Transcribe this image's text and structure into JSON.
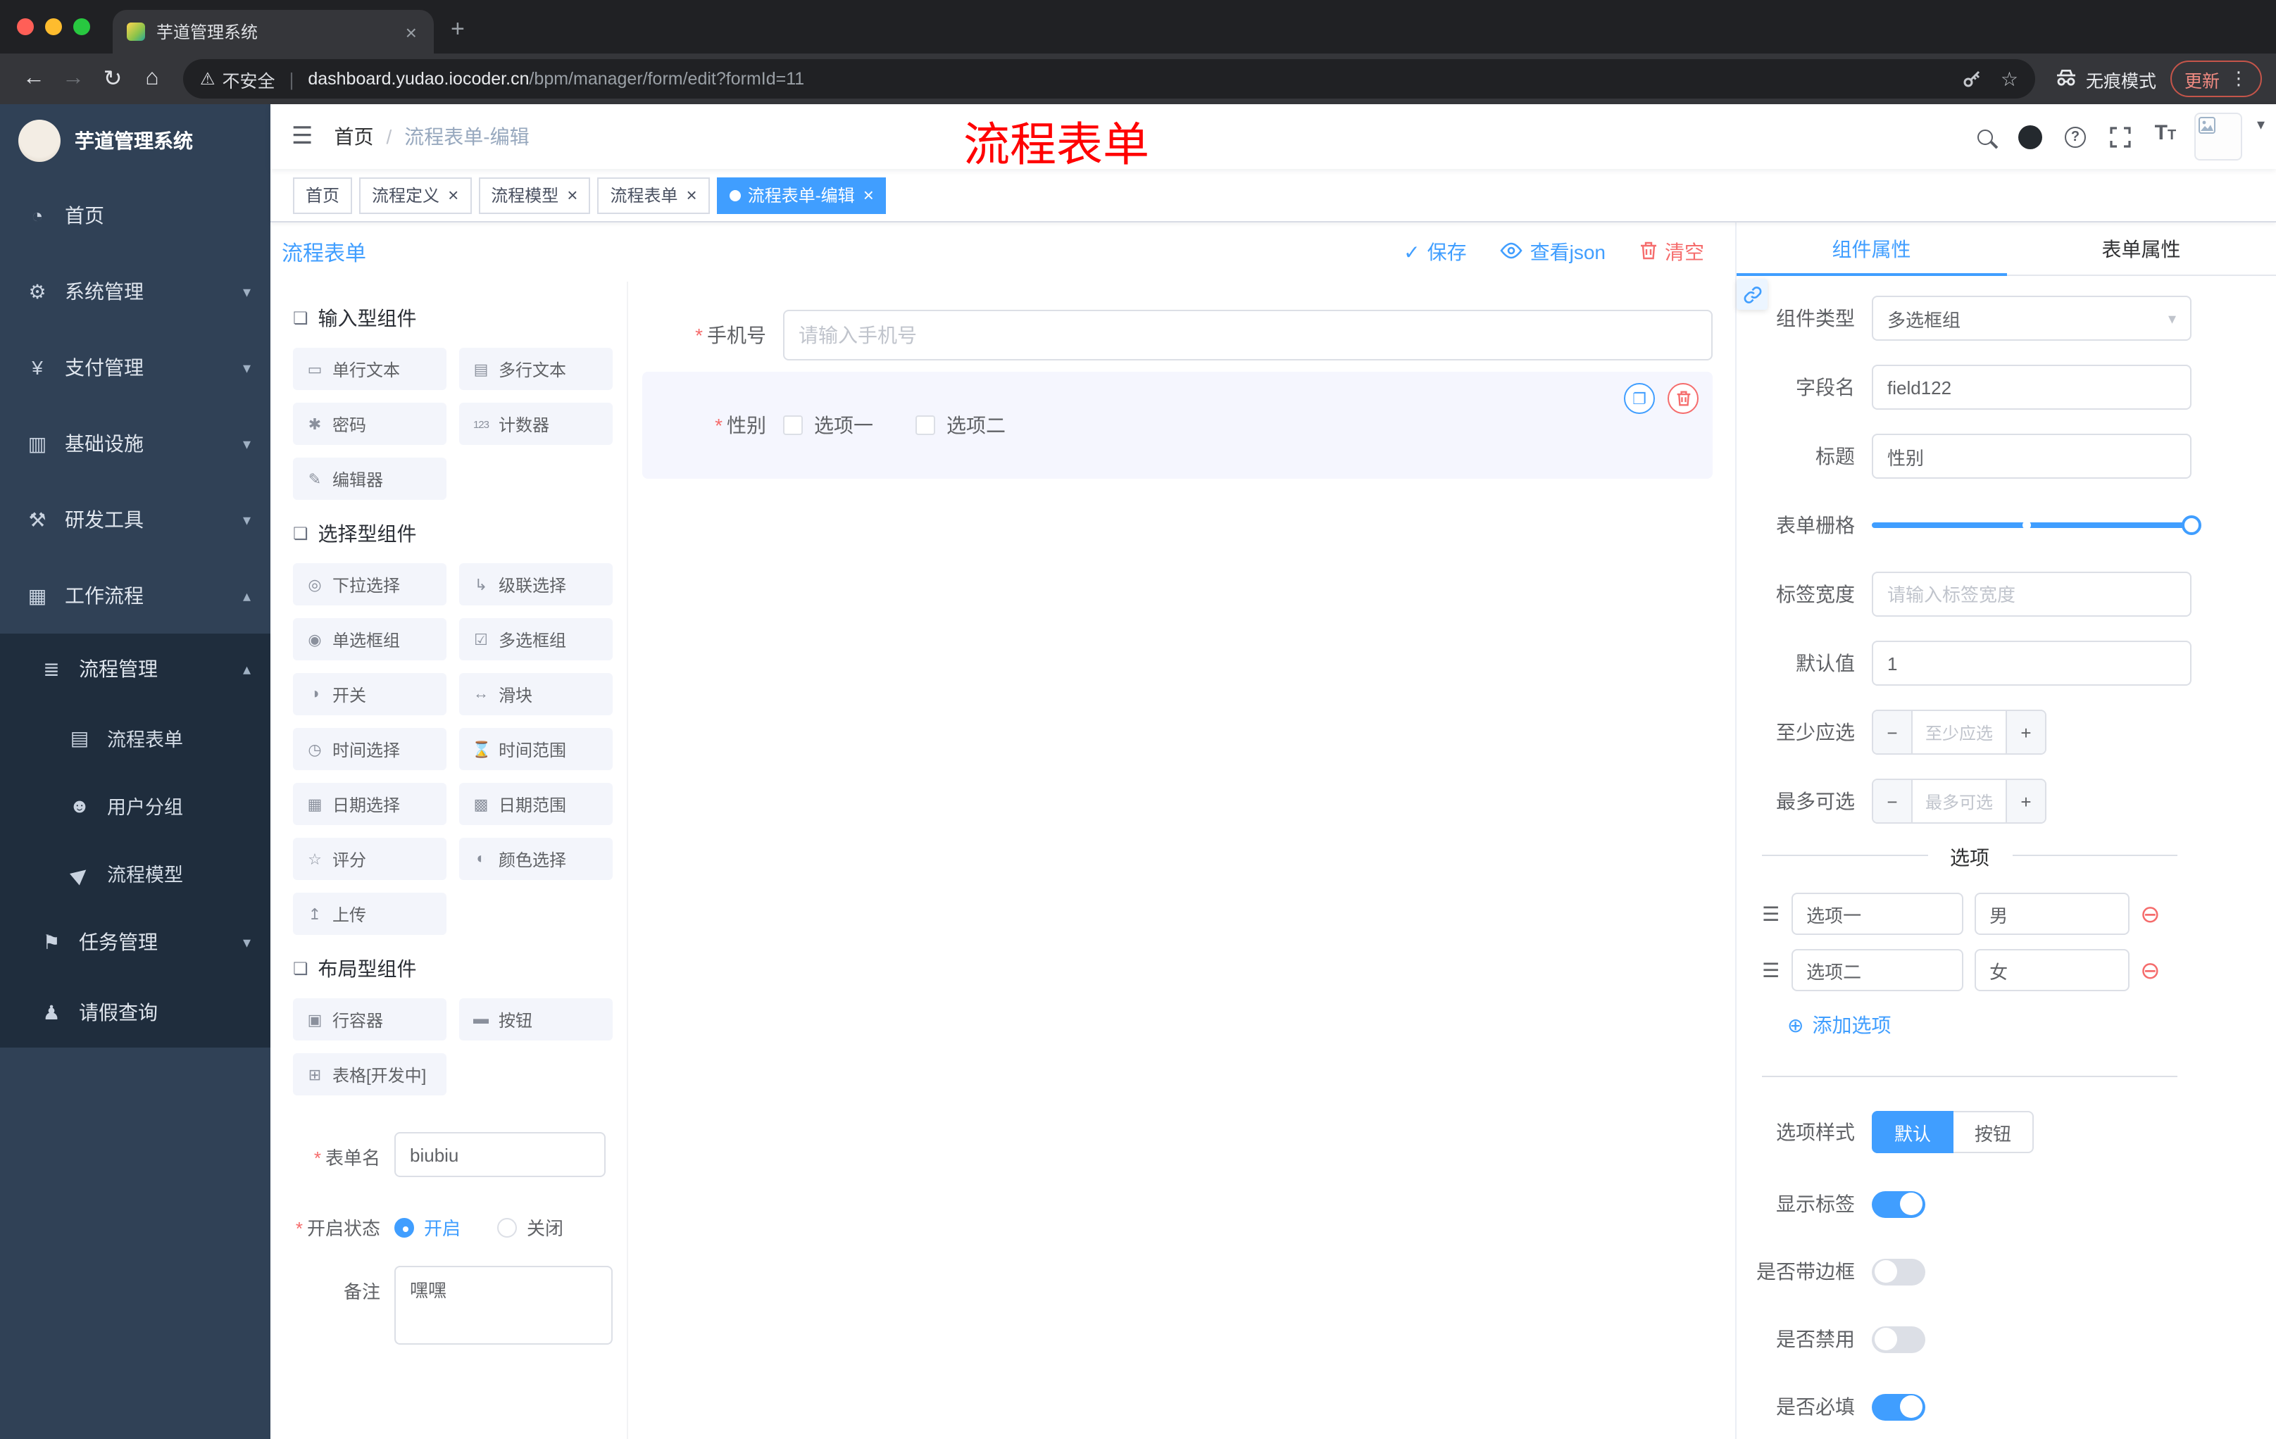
{
  "colors": {
    "accent": "#409EFF",
    "danger": "#F56C6C",
    "annotation_red": "#FF0000",
    "sidebar_bg": "#304156",
    "sidebar_sub_bg": "#1F2D3D"
  },
  "icons": {
    "close": "×",
    "plus": "+",
    "back": "←",
    "forward": "→",
    "reload": "↻",
    "home": "⌂",
    "warning": "⚠",
    "star": "☆",
    "dots": "⋮",
    "hamburger": "☰",
    "crumb_sep": "/",
    "question": "?",
    "caret_down": "▾",
    "chev_down": "▾",
    "chev_up": "▴",
    "menu_home": "◔",
    "menu_system": "⚙",
    "menu_pay": "¥",
    "menu_infra": "▥",
    "menu_dev": "⚒",
    "menu_flow": "▦",
    "menu_flowmng": "≣",
    "menu_form": "▤",
    "menu_group": "☻",
    "menu_model": "▶",
    "menu_task": "⚑",
    "menu_leave": "♟",
    "group": "❏",
    "ci_input": "▭",
    "ci_textarea": "▤",
    "ci_password": "✱",
    "ci_counter": "123",
    "ci_editor": "✎",
    "ci_select": "◎",
    "ci_cascader": "↳",
    "ci_radio": "◉",
    "ci_checkbox": "☑",
    "ci_switch": "◑",
    "ci_slider": "↔",
    "ci_time": "◷",
    "ci_timerange": "⌛",
    "ci_date": "▦",
    "ci_daterange": "▩",
    "ci_rate": "☆",
    "ci_color": "◐",
    "ci_upload": "↥",
    "ci_row": "▣",
    "ci_button": "▬",
    "ci_table": "⊞",
    "check": "✓",
    "copy": "❐",
    "drag": "☰",
    "remove": "⊖",
    "add": "⊕",
    "minus": "−",
    "stepper_plus": "+",
    "select_caret": "▾",
    "fontsize_big": "T",
    "fontsize_small": "T"
  },
  "browser": {
    "tab_title": "芋道管理系统",
    "security_text": "不安全",
    "url_domain": "dashboard.yudao.iocoder.cn",
    "url_path": "/bpm/manager/form/edit?formId=11",
    "incognito_label": "无痕模式",
    "update_label": "更新"
  },
  "sidebar": {
    "logo_title": "芋道管理系统",
    "items": [
      {
        "label": "首页"
      },
      {
        "label": "系统管理"
      },
      {
        "label": "支付管理"
      },
      {
        "label": "基础设施"
      },
      {
        "label": "研发工具"
      },
      {
        "label": "工作流程"
      }
    ],
    "sub": {
      "manage": "流程管理",
      "children": [
        {
          "label": "流程表单"
        },
        {
          "label": "用户分组"
        },
        {
          "label": "流程模型"
        }
      ],
      "task": "任务管理",
      "leave": "请假查询"
    }
  },
  "header": {
    "breadcrumb_home": "首页",
    "breadcrumb_current": "流程表单-编辑",
    "annotation": "流程表单"
  },
  "tags": [
    {
      "label": "首页"
    },
    {
      "label": "流程定义"
    },
    {
      "label": "流程模型"
    },
    {
      "label": "流程表单"
    },
    {
      "label": "流程表单-编辑"
    }
  ],
  "designer": {
    "title": "流程表单",
    "save": "保存",
    "view_json": "查看json",
    "clear": "清空",
    "groups": [
      {
        "title": "输入型组件",
        "items": [
          {
            "label": "单行文本"
          },
          {
            "label": "多行文本"
          },
          {
            "label": "密码"
          },
          {
            "label": "计数器"
          },
          {
            "label": "编辑器"
          }
        ]
      },
      {
        "title": "选择型组件",
        "items": [
          {
            "label": "下拉选择"
          },
          {
            "label": "级联选择"
          },
          {
            "label": "单选框组"
          },
          {
            "label": "多选框组"
          },
          {
            "label": "开关"
          },
          {
            "label": "滑块"
          },
          {
            "label": "时间选择"
          },
          {
            "label": "时间范围"
          },
          {
            "label": "日期选择"
          },
          {
            "label": "日期范围"
          },
          {
            "label": "评分"
          },
          {
            "label": "颜色选择"
          },
          {
            "label": "上传"
          }
        ]
      },
      {
        "title": "布局型组件",
        "items": [
          {
            "label": "行容器"
          },
          {
            "label": "按钮"
          },
          {
            "label": "表格[开发中]"
          }
        ]
      }
    ],
    "meta": {
      "name_label": "表单名",
      "name_value": "biubiu",
      "status_label": "开启状态",
      "status_on": "开启",
      "status_off": "关闭",
      "remark_label": "备注",
      "remark_value": "嘿嘿"
    },
    "canvas": {
      "phone_label": "手机号",
      "phone_placeholder": "请输入手机号",
      "gender_label": "性别",
      "gender_opt1": "选项一",
      "gender_opt2": "选项二"
    }
  },
  "props": {
    "tab_component": "组件属性",
    "tab_form": "表单属性",
    "type_label": "组件类型",
    "type_value": "多选框组",
    "field_label": "字段名",
    "field_value": "field122",
    "title_label": "标题",
    "title_value": "性别",
    "grid_label": "表单栅格",
    "width_label": "标签宽度",
    "width_placeholder": "请输入标签宽度",
    "default_label": "默认值",
    "default_value": "1",
    "min_label": "至少应选",
    "min_placeholder": "至少应选",
    "max_label": "最多可选",
    "max_placeholder": "最多可选",
    "options_title": "选项",
    "options": [
      {
        "name": "选项一",
        "value": "男"
      },
      {
        "name": "选项二",
        "value": "女"
      }
    ],
    "add_option": "添加选项",
    "style_label": "选项样式",
    "style_default": "默认",
    "style_button": "按钮",
    "show_label_label": "显示标签",
    "border_label": "是否带边框",
    "disabled_label": "是否禁用",
    "required_label": "是否必填"
  }
}
